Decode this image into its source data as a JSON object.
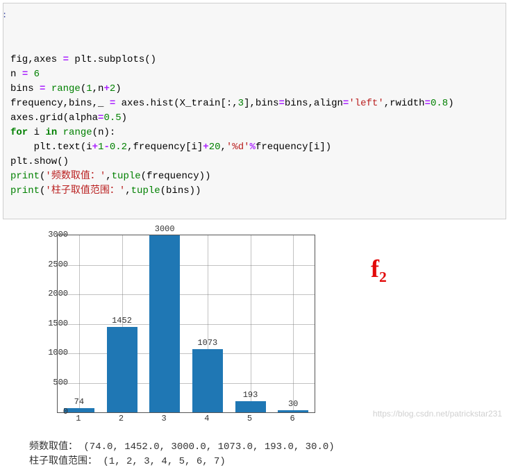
{
  "code": {
    "lines_html": [
      "fig,axes <span class='op'>=</span> plt.subplots()",
      "n <span class='op'>=</span> <span class='num'>6</span>",
      "bins <span class='op'>=</span> <span class='builtin'>range</span>(<span class='num'>1</span>,n<span class='op'>+</span><span class='num'>2</span>)",
      "frequency,bins,_ <span class='op'>=</span> axes.hist(X_train[:,<span class='num'>3</span>],bins<span class='op'>=</span>bins,align<span class='op'>=</span><span class='str'>'left'</span>,rwidth<span class='op'>=</span><span class='num'>0.8</span>)",
      "axes.grid(alpha<span class='op'>=</span><span class='num'>0.5</span>)",
      "<span class='kw'>for</span> i <span class='kw'>in</span> <span class='builtin'>range</span>(n):",
      "    plt.text(i<span class='op'>+</span><span class='num'>1</span><span class='op'>-</span><span class='num'>0.2</span>,frequency[i]<span class='op'>+</span><span class='num'>20</span>,<span class='str'>'%d'</span><span class='op'>%</span>frequency[i])",
      "plt.show()",
      "<span class='builtin'>print</span>(<span class='str'>'频数取值：'</span>,<span class='builtin'>tuple</span>(frequency))",
      "<span class='builtin'>print</span>(<span class='str'>'柱子取值范围：'</span>,<span class='builtin'>tuple</span>(bins))"
    ]
  },
  "chart_data": {
    "type": "bar",
    "categories": [
      "1",
      "2",
      "3",
      "4",
      "5",
      "6"
    ],
    "values": [
      74,
      1452,
      3000,
      1073,
      193,
      30
    ],
    "title": "",
    "xlabel": "",
    "ylabel": "",
    "ylim": [
      0,
      3000
    ],
    "yticks": [
      0,
      500,
      1000,
      1500,
      2000,
      2500,
      3000
    ]
  },
  "annotation_text": "f₂",
  "printed_output": {
    "line1": "频数取值： (74.0, 1452.0, 3000.0, 1073.0, 193.0, 30.0)",
    "line2": "柱子取值范围： (1, 2, 3, 4, 5, 6, 7)"
  },
  "watermark": "https://blog.csdn.net/patrickstar231"
}
